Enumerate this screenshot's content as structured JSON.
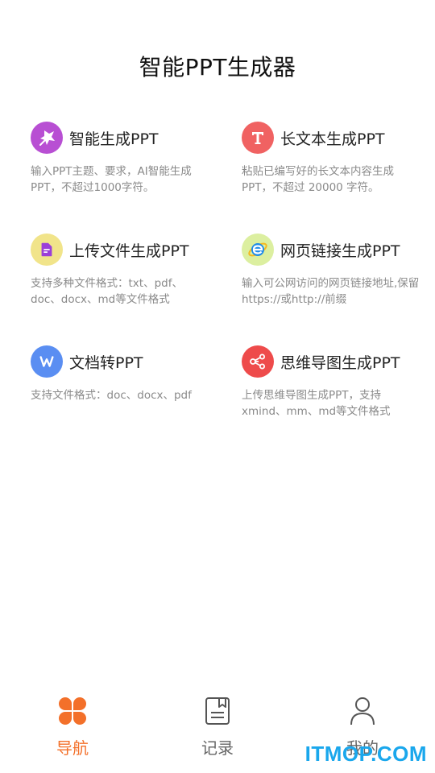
{
  "header": {
    "title": "智能PPT生成器"
  },
  "features": [
    {
      "title": "智能生成PPT",
      "desc": "输入PPT主题、要求，AI智能生成PPT，不超过1000字符。",
      "icon": "sparkle-icon",
      "color": "#b84fd3"
    },
    {
      "title": "长文本生成PPT",
      "desc": "粘贴已编写好的长文本内容生成PPT，不超过 20000 字符。",
      "icon": "letter-t-icon",
      "color": "#f06262"
    },
    {
      "title": "上传文件生成PPT",
      "desc": "支持多种文件格式：txt、pdf、doc、docx、md等文件格式",
      "icon": "document-icon",
      "color": "#f1e48a"
    },
    {
      "title": "网页链接生成PPT",
      "desc": "输入可公网访问的网页链接地址,保留https://或http://前缀",
      "icon": "browser-e-icon",
      "color": "#dcefa0"
    },
    {
      "title": "文档转PPT",
      "desc": "支持文件格式：doc、docx、pdf",
      "icon": "word-w-icon",
      "color": "#5a8ef2"
    },
    {
      "title": "思维导图生成PPT",
      "desc": "上传思维导图生成PPT，支持xmind、mm、md等文件格式",
      "icon": "share-nodes-icon",
      "color": "#ee4b4b"
    }
  ],
  "tabbar": {
    "items": [
      {
        "label": "导航",
        "icon": "clover-grid-icon",
        "active": true
      },
      {
        "label": "记录",
        "icon": "bookmark-doc-icon",
        "active": false
      },
      {
        "label": "我的",
        "icon": "user-icon",
        "active": false
      }
    ],
    "accent": "#f3702a"
  },
  "watermark": "ITMOP.COM"
}
